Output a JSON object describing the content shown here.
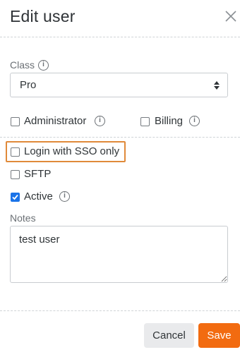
{
  "dialog": {
    "title": "Edit user",
    "close_icon": "close-icon"
  },
  "class_field": {
    "label": "Class",
    "info_icon": "info-icon",
    "selected": "Pro",
    "arrow_icon": "sort-arrows-icon"
  },
  "roles": {
    "administrator": {
      "label": "Administrator",
      "checked": false
    },
    "billing": {
      "label": "Billing",
      "checked": false
    }
  },
  "options": {
    "sso_only": {
      "label": "Login with SSO only",
      "checked": false
    },
    "sftp": {
      "label": "SFTP",
      "checked": false
    },
    "active": {
      "label": "Active",
      "checked": true
    }
  },
  "notes": {
    "label": "Notes",
    "value": "test user"
  },
  "footer": {
    "cancel_label": "Cancel",
    "save_label": "Save"
  },
  "colors": {
    "accent": "#f26b10",
    "checkbox_checked": "#1a73e8",
    "highlight": "#e08a3a"
  }
}
